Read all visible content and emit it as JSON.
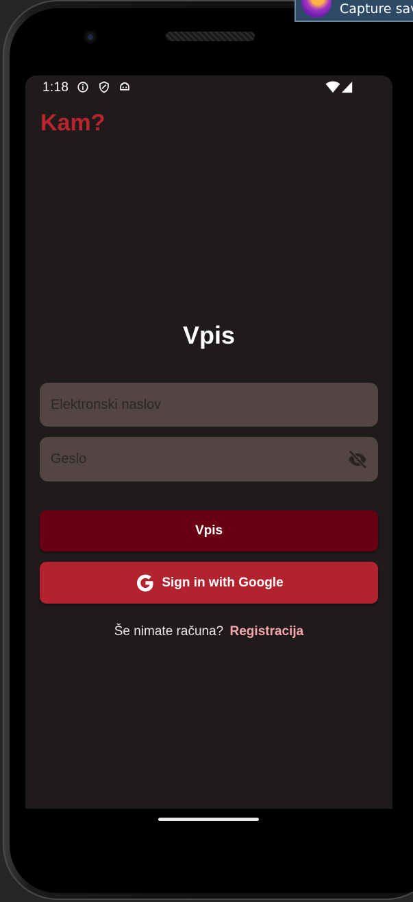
{
  "status_bar": {
    "time": "1:18",
    "left_icons": [
      "info-icon",
      "shield-icon",
      "android-icon"
    ],
    "right_icons": [
      "wifi-icon",
      "cell-signal-icon"
    ]
  },
  "app": {
    "title": "Kam?",
    "accent_color": "#b8252f"
  },
  "login_form": {
    "title": "Vpis",
    "email_placeholder": "Elektronski naslov",
    "email_value": "",
    "password_placeholder": "Geslo",
    "password_value": "",
    "password_toggle_icon": "eye-off-icon",
    "submit_label": "Vpis",
    "google_label": "Sign in with Google",
    "google_icon": "google-g-icon"
  },
  "register": {
    "prompt": "Še nimate računa?",
    "link_label": "Registracija"
  },
  "notification": {
    "text": "Capture save",
    "icon": "screenshot-tool-icon"
  },
  "colors": {
    "screen_bg": "#201b1b",
    "field_bg": "#534545",
    "login_button": "#6a0013",
    "google_button": "#b2232f",
    "register_link": "#f7a7ac"
  }
}
